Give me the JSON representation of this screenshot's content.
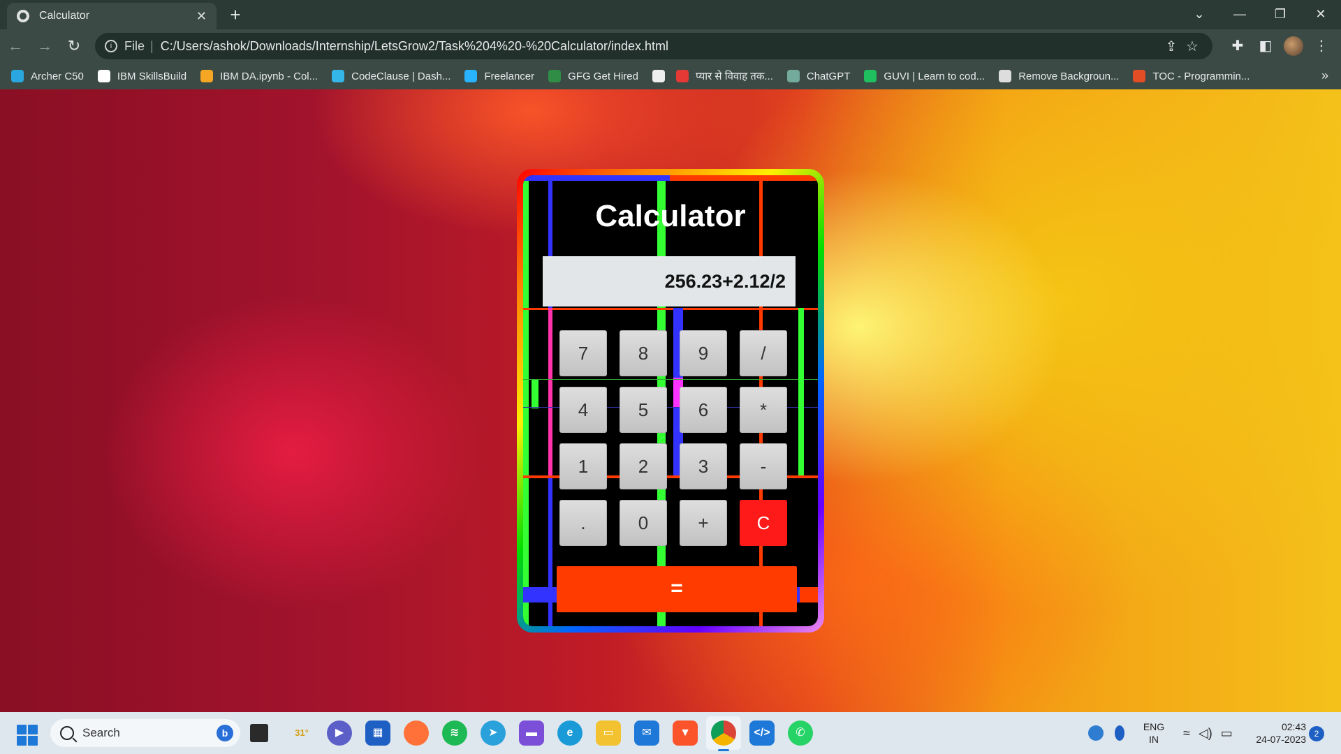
{
  "browser": {
    "tab_title": "Calculator",
    "tab_close": "✕",
    "new_tab": "+",
    "window_controls": [
      "⌄",
      "—",
      "❐",
      "✕"
    ],
    "scheme": "File",
    "separator": "|",
    "url": "C:/Users/ashok/Downloads/Internship/LetsGrow2/Task%204%20-%20Calculator/index.html",
    "bookmarks": [
      {
        "label": "Archer C50",
        "color": "#2aa7df"
      },
      {
        "label": "IBM SkillsBuild",
        "color": "#ffffff"
      },
      {
        "label": "IBM DA.ipynb - Col...",
        "color": "#f5a623"
      },
      {
        "label": "CodeClause | Dash...",
        "color": "#34b6e8"
      },
      {
        "label": "Freelancer",
        "color": "#29b2fe"
      },
      {
        "label": "GFG Get Hired",
        "color": "#2f8d46"
      },
      {
        "label": "",
        "color": "#eeeeee"
      },
      {
        "label": "प्यार से विवाह तक...",
        "color": "#e53935"
      },
      {
        "label": "ChatGPT",
        "color": "#74aa9c"
      },
      {
        "label": "GUVI | Learn to cod...",
        "color": "#1fbf5f"
      },
      {
        "label": "Remove Backgroun...",
        "color": "#dddddd"
      },
      {
        "label": "TOC - Programmin...",
        "color": "#e34d26"
      }
    ],
    "bookmarks_more": "»"
  },
  "calculator": {
    "title": "Calculator",
    "display_value": "256.23+2.12/2",
    "keys": [
      "7",
      "8",
      "9",
      "/",
      "4",
      "5",
      "6",
      "*",
      "1",
      "2",
      "3",
      "-",
      ".",
      "0",
      "+",
      "C"
    ],
    "equals": "="
  },
  "taskbar": {
    "search_placeholder": "Search",
    "bing_label": "b",
    "weather_temp": "31°",
    "lang_top": "ENG",
    "lang_bottom": "IN",
    "time": "02:43",
    "date": "24-07-2023",
    "notification_count": "2"
  }
}
